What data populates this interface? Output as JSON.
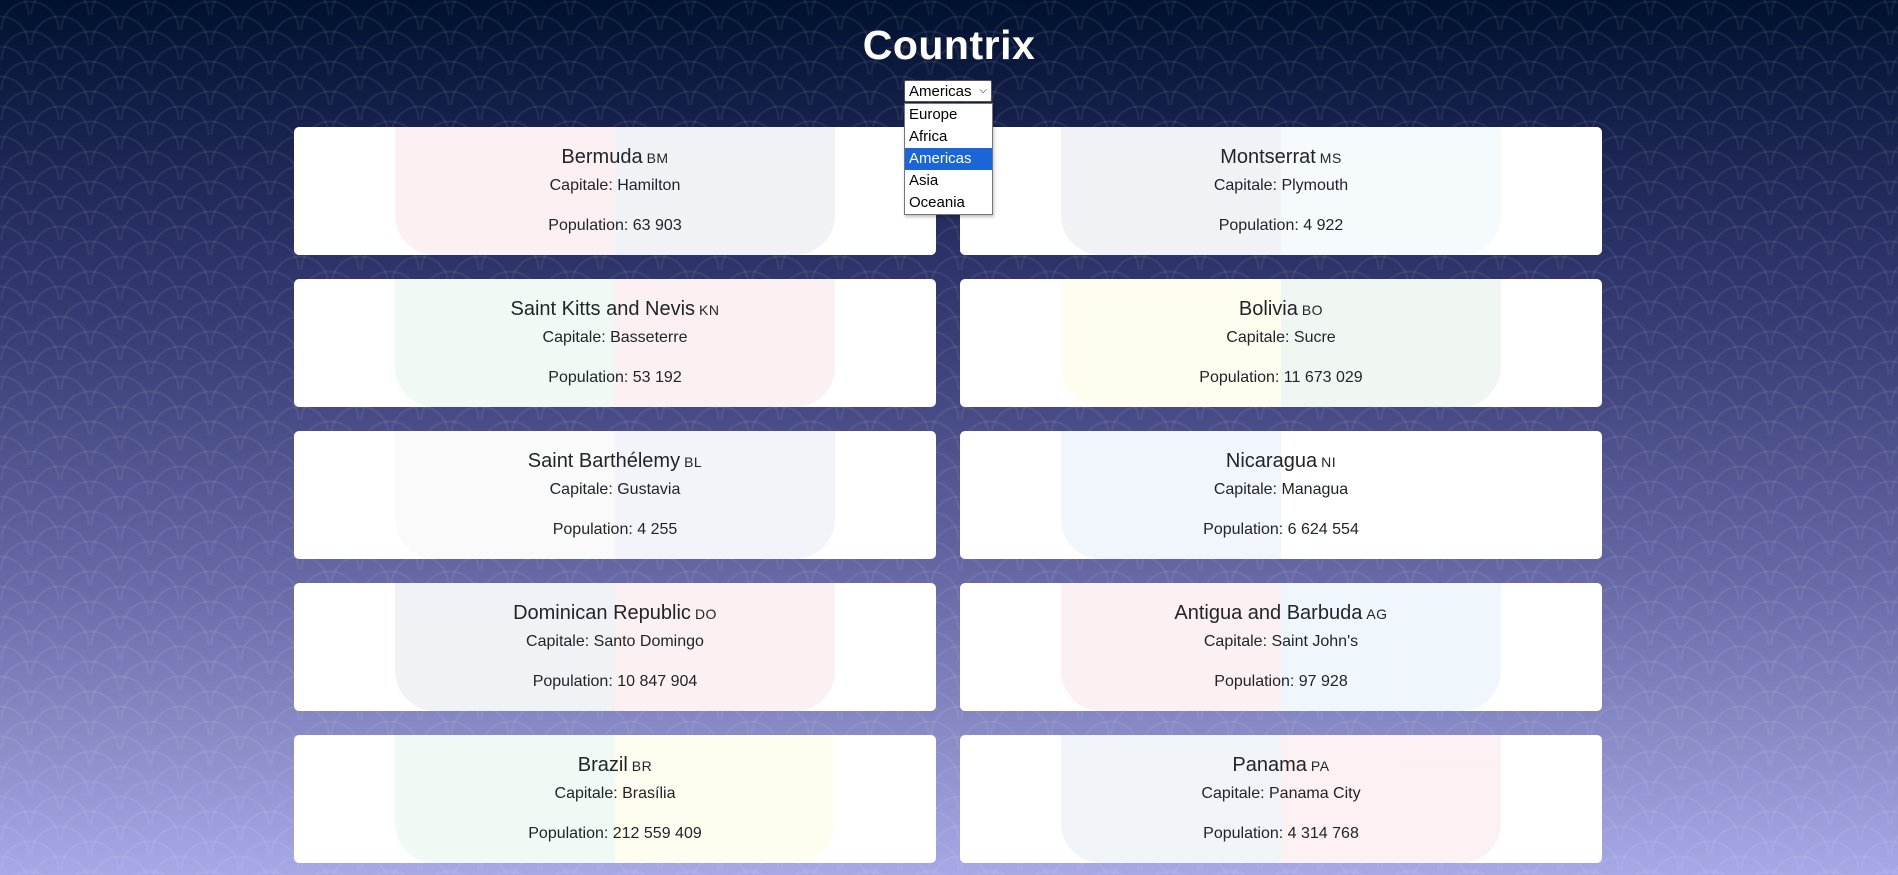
{
  "app": {
    "title": "Countrix"
  },
  "region_filter": {
    "selected": "Americas",
    "options": [
      "Europe",
      "Africa",
      "Americas",
      "Asia",
      "Oceania"
    ]
  },
  "colors": {
    "background_top": "#00112e",
    "background_bottom": "#a6a9e6",
    "card": "#ffffff",
    "selected_option": "#1a66d9"
  },
  "countries": [
    {
      "name": "Bermuda",
      "code": "BM",
      "capital": "Capitale: Hamilton",
      "population": "Population: 63 903",
      "flag_colors": [
        "#c8102e",
        "#012169"
      ]
    },
    {
      "name": "Montserrat",
      "code": "MS",
      "capital": "Capitale: Plymouth",
      "population": "Population: 4 922",
      "flag_colors": [
        "#012169",
        "#5ba4d6"
      ]
    },
    {
      "name": "Saint Kitts and Nevis",
      "code": "KN",
      "capital": "Capitale: Basseterre",
      "population": "Population: 53 192",
      "flag_colors": [
        "#009e49",
        "#ce1126"
      ]
    },
    {
      "name": "Bolivia",
      "code": "BO",
      "capital": "Capitale: Sucre",
      "population": "Population: 11 673 029",
      "flag_colors": [
        "#f9e300",
        "#007a33"
      ]
    },
    {
      "name": "Saint Barthélemy",
      "code": "BL",
      "capital": "Capitale: Gustavia",
      "population": "Population: 4 255",
      "flag_colors": [
        "#b0b0b0",
        "#2a4fa0"
      ]
    },
    {
      "name": "Nicaragua",
      "code": "NI",
      "capital": "Capitale: Managua",
      "population": "Population: 6 624 554",
      "flag_colors": [
        "#0067c6",
        "#ffffff"
      ]
    },
    {
      "name": "Dominican Republic",
      "code": "DO",
      "capital": "Capitale: Santo Domingo",
      "population": "Population: 10 847 904",
      "flag_colors": [
        "#002d62",
        "#ce1126"
      ]
    },
    {
      "name": "Antigua and Barbuda",
      "code": "AG",
      "capital": "Capitale: Saint John's",
      "population": "Population: 97 928",
      "flag_colors": [
        "#ce1126",
        "#0072c6"
      ]
    },
    {
      "name": "Brazil",
      "code": "BR",
      "capital": "Capitale: Brasília",
      "population": "Population: 212 559 409",
      "flag_colors": [
        "#009c3b",
        "#ffdf00"
      ]
    },
    {
      "name": "Panama",
      "code": "PA",
      "capital": "Capitale: Panama City",
      "population": "Population: 4 314 768",
      "flag_colors": [
        "#005293",
        "#d21034"
      ]
    }
  ]
}
